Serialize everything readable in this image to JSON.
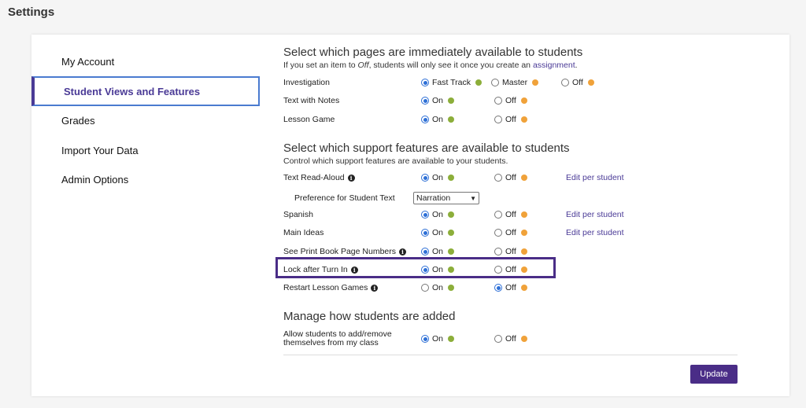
{
  "page": {
    "title": "Settings"
  },
  "nav": {
    "items": [
      {
        "label": "My Account"
      },
      {
        "label": "Student Views and Features"
      },
      {
        "label": "Grades"
      },
      {
        "label": "Import Your Data"
      },
      {
        "label": "Admin Options"
      }
    ]
  },
  "pages_section": {
    "title": "Select which pages are immediately available to students",
    "sub_prefix": "If you set an item to ",
    "sub_em": "Off",
    "sub_mid": ", students will only see it once you create an ",
    "sub_link": "assignment",
    "sub_end": ".",
    "rows": [
      {
        "label": "Investigation",
        "opt1": "Fast Track",
        "opt2": "Master",
        "opt3": "Off"
      },
      {
        "label": "Text with Notes",
        "opt1": "On",
        "opt2": "Off"
      },
      {
        "label": "Lesson Game",
        "opt1": "On",
        "opt2": "Off"
      }
    ]
  },
  "support_section": {
    "title": "Select which support features are available to students",
    "sub": "Control which support features are available to your students.",
    "rows": [
      {
        "label": "Text Read-Aloud",
        "opt1": "On",
        "opt2": "Off",
        "edit": "Edit per student"
      },
      {
        "label": "Spanish",
        "opt1": "On",
        "opt2": "Off",
        "edit": "Edit per student"
      },
      {
        "label": "Main Ideas",
        "opt1": "On",
        "opt2": "Off",
        "edit": "Edit per student"
      },
      {
        "label": "See Print Book Page Numbers",
        "opt1": "On",
        "opt2": "Off"
      },
      {
        "label": "Lock after Turn In",
        "opt1": "On",
        "opt2": "Off"
      },
      {
        "label": "Restart Lesson Games",
        "opt1": "On",
        "opt2": "Off"
      }
    ],
    "preference": {
      "label": "Preference for Student Text",
      "value": "Narration"
    }
  },
  "students_section": {
    "title": "Manage how students are added",
    "row": {
      "label_line1": "Allow students to add/remove",
      "label_line2": "themselves from my class",
      "opt1": "On",
      "opt2": "Off"
    }
  },
  "actions": {
    "update": "Update"
  },
  "colors": {
    "accent": "#4a2d87",
    "on_dot": "#8cae3a",
    "off_dot": "#f0a23a",
    "radio": "#2d6fd6"
  }
}
